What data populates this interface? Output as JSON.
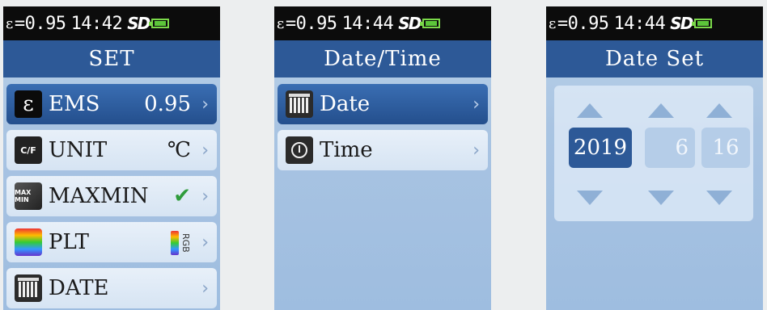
{
  "statusbar": {
    "epsilon_symbol": "ε",
    "emissivity": "=0.95",
    "screen1_time": "14:42",
    "screen2_time": "14:44",
    "screen3_time": "14:44",
    "sd_label": "SD"
  },
  "screen1": {
    "title": "SET",
    "items": [
      {
        "icon": "epsilon-icon",
        "icon_text": "ε",
        "label": "EMS",
        "value": "0.95",
        "selected": true
      },
      {
        "icon": "celsius-fahrenheit-icon",
        "icon_text": "C/F",
        "label": "UNIT",
        "value": "℃"
      },
      {
        "icon": "maxmin-icon",
        "icon_text": "MAX MIN",
        "label": "MAXMIN",
        "value": "✔"
      },
      {
        "icon": "palette-icon",
        "label": "PLT",
        "value_text": "RGB"
      },
      {
        "icon": "calendar-icon",
        "label": "DATE"
      }
    ],
    "chevron": "›"
  },
  "screen2": {
    "title": "Date/Time",
    "items": [
      {
        "icon": "calendar-icon",
        "label": "Date",
        "selected": true
      },
      {
        "icon": "alarm-clock-icon",
        "label": "Time"
      }
    ],
    "chevron": "›"
  },
  "screen3": {
    "title": "Date Set",
    "year": "2019",
    "month": "6",
    "day": "16",
    "selected_field": "year"
  },
  "colors": {
    "title_bar": "#2d5997",
    "selected_row": "#2d5997",
    "screen_bg": "#a9c4e2",
    "check": "#2f9c3c"
  }
}
